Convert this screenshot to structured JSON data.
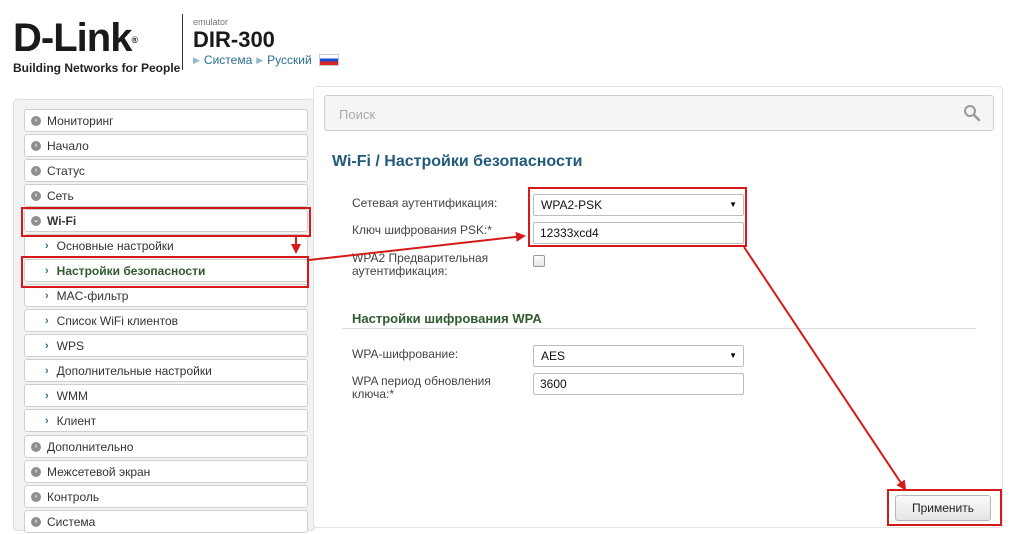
{
  "header": {
    "logo_text": "D-Link",
    "logo_reg": "®",
    "tagline": "Building Networks for People",
    "emulator_label": "emulator",
    "model": "DIR-300",
    "crumbs": [
      "Система",
      "Русский"
    ]
  },
  "sidebar": {
    "items": [
      {
        "label": "Мониторинг",
        "icon": "expand-dot-icon"
      },
      {
        "label": "Начало",
        "icon": "expand-dot-icon"
      },
      {
        "label": "Статус",
        "icon": "expand-dot-icon"
      },
      {
        "label": "Сеть",
        "icon": "expand-dot-icon"
      },
      {
        "label": "Wi-Fi",
        "icon": "collapse-dot-icon"
      },
      {
        "label": "Основные настройки",
        "icon": "chevron-right-icon"
      },
      {
        "label": "Настройки безопасности",
        "icon": "chevron-right-icon"
      },
      {
        "label": "MAC-фильтр",
        "icon": "chevron-right-icon"
      },
      {
        "label": "Список WiFi клиентов",
        "icon": "chevron-right-icon"
      },
      {
        "label": "WPS",
        "icon": "chevron-right-icon"
      },
      {
        "label": "Дополнительные настройки",
        "icon": "chevron-right-icon"
      },
      {
        "label": "WMM",
        "icon": "chevron-right-icon"
      },
      {
        "label": "Клиент",
        "icon": "chevron-right-icon"
      },
      {
        "label": "Дополнительно",
        "icon": "expand-dot-icon"
      },
      {
        "label": "Межсетевой экран",
        "icon": "expand-dot-icon"
      },
      {
        "label": "Контроль",
        "icon": "expand-dot-icon"
      },
      {
        "label": "Система",
        "icon": "expand-dot-icon"
      }
    ]
  },
  "search": {
    "placeholder": "Поиск"
  },
  "page": {
    "title": "Wi-Fi /  Настройки безопасности"
  },
  "form": {
    "auth_label": "Сетевая аутентификация:",
    "auth_value": "WPA2-PSK",
    "psk_label": "Ключ шифрования PSK:*",
    "psk_value": "12333xcd4",
    "preauth_label_1": "WPA2 Предварительная",
    "preauth_label_2": "аутентификация:",
    "preauth_checked": false,
    "wpa_section_title": "Настройки шифрования WPA",
    "wpa_enc_label": "WPA-шифрование:",
    "wpa_enc_value": "AES",
    "rekey_label_1": "WPA период обновления",
    "rekey_label_2": "ключа:*",
    "rekey_value": "3600"
  },
  "actions": {
    "apply_label": "Применить"
  },
  "colors": {
    "accent": "#1f5b7a",
    "section": "#2f5b2d",
    "annotation": "#d61a1a"
  }
}
